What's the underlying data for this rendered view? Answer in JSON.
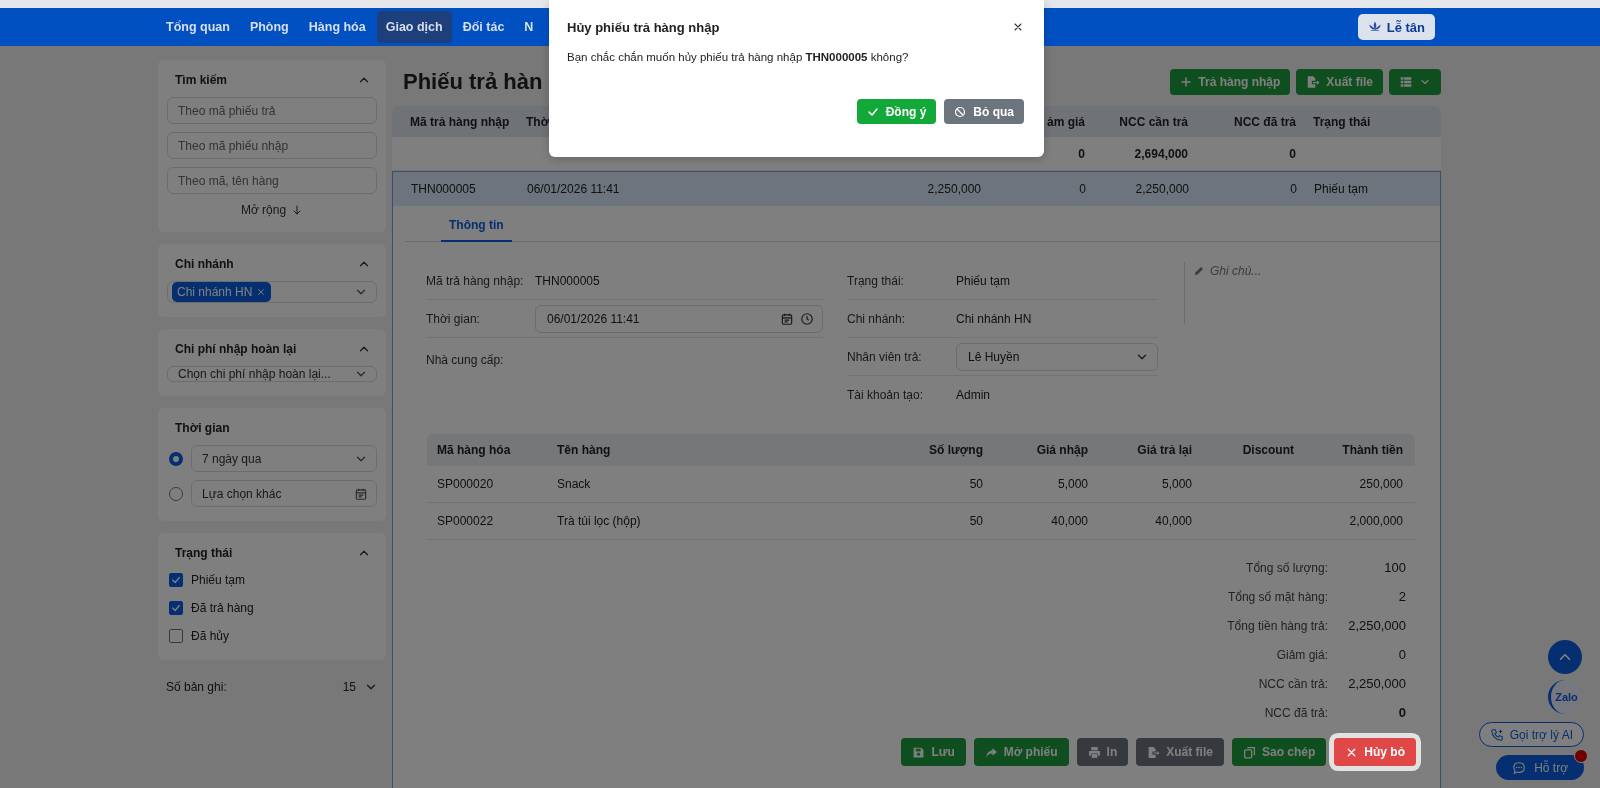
{
  "nav": {
    "items": [
      {
        "label": "Tổng quan",
        "selected": false
      },
      {
        "label": "Phòng",
        "selected": false
      },
      {
        "label": "Hàng hóa",
        "selected": false
      },
      {
        "label": "Giao dịch",
        "selected": true
      },
      {
        "label": "Đối tác",
        "selected": false
      },
      {
        "label": "N",
        "selected": false
      }
    ],
    "reception_button": "Lễ tân"
  },
  "sidebar": {
    "cards": [
      {
        "kind": "search",
        "title": "Tìm kiếm",
        "expanded": true,
        "fields": [
          {
            "placeholder": "Theo mã phiếu trả"
          },
          {
            "placeholder": "Theo mã phiếu nhập"
          },
          {
            "placeholder": "Theo mã, tên hàng"
          }
        ],
        "more_link": "Mở rộng"
      },
      {
        "kind": "tags",
        "title": "Chi nhánh",
        "expanded": true,
        "tags": [
          "Chi nhánh HN"
        ]
      },
      {
        "kind": "select",
        "title": "Chi phí nhập hoàn lại",
        "expanded": true,
        "value": "Chọn chi phí nhập hoàn lại..."
      },
      {
        "kind": "radios",
        "title": "Thời gian",
        "options": [
          {
            "label": "7 ngày qua",
            "selected": true,
            "kind": "select"
          },
          {
            "label": "Lựa chọn khác",
            "selected": false,
            "kind": "date"
          }
        ]
      },
      {
        "kind": "checks",
        "title": "Trạng thái",
        "expanded": true,
        "items": [
          {
            "label": "Phiếu tạm",
            "checked": true
          },
          {
            "label": "Đã trả hàng",
            "checked": true
          },
          {
            "label": "Đã hủy",
            "checked": false
          }
        ]
      }
    ],
    "records": {
      "label": "Số bản ghi:",
      "value": "15"
    }
  },
  "main": {
    "title": "Phiếu trả hàn",
    "actions": [
      {
        "kind": "add",
        "label": "Trả hàng nhập"
      },
      {
        "kind": "export",
        "label": "Xuất file"
      },
      {
        "kind": "columns"
      }
    ],
    "table": {
      "columns": [
        "Mã trả hàng nhập",
        "Thờ",
        null,
        "ảm giá",
        "NCC cần trả",
        "NCC đã trả",
        "Trạng thái"
      ],
      "rows": [
        {
          "kind": "summary",
          "selected": false,
          "cells": [
            null,
            null,
            null,
            "0",
            "2,694,000",
            "0",
            null
          ]
        },
        {
          "kind": "record",
          "selected": true,
          "cells": [
            "THN000005",
            "06/01/2026 11:41",
            "2,250,000",
            "0",
            "2,250,000",
            "0",
            "Phiếu tạm"
          ]
        }
      ]
    },
    "detail": {
      "tabs": [
        {
          "label": "Thông tin",
          "selected": true
        }
      ],
      "left_fields": [
        {
          "kind": "text",
          "label": "Mã trả hàng nhập:",
          "value": "THN000005"
        },
        {
          "kind": "datetime",
          "label": "Thời gian:",
          "value": "06/01/2026 11:41"
        },
        {
          "kind": "text",
          "label": "Nhà cung cấp:"
        }
      ],
      "right_fields": [
        {
          "kind": "text",
          "label": "Trạng thái:",
          "value": "Phiếu tạm"
        },
        {
          "kind": "text",
          "label": "Chi nhánh:",
          "value": "Chi nhánh HN"
        },
        {
          "kind": "select",
          "label": "Nhân viên trả:",
          "value": "Lê Huyền"
        },
        {
          "kind": "text",
          "label": "Tài khoản tạo:",
          "value": "Admin"
        }
      ],
      "note": {
        "placeholder": "Ghi chú..."
      },
      "items": {
        "columns": [
          "Mã hàng hóa",
          "Tên hàng",
          "Số lượng",
          "Giá nhập",
          "Giá trả lại",
          "Discount",
          "Thành tiền"
        ],
        "rows": [
          [
            "SP000020",
            "Snack",
            "50",
            "5,000",
            "5,000",
            null,
            "250,000"
          ],
          [
            "SP000022",
            "Trà túi lọc (hộp)",
            "50",
            "40,000",
            "40,000",
            null,
            "2,000,000"
          ]
        ]
      },
      "totals": [
        {
          "label": "Tổng số lượng:",
          "value": "100",
          "bold": false
        },
        {
          "label": "Tổng số mặt hàng:",
          "value": "2",
          "bold": false
        },
        {
          "label": "Tổng tiền hàng trả:",
          "value": "2,250,000",
          "bold": false
        },
        {
          "label": "Giảm giá:",
          "value": "0",
          "bold": false
        },
        {
          "label": "NCC cần trả:",
          "value": "2,250,000",
          "bold": false
        },
        {
          "label": "NCC đã trả:",
          "value": "0",
          "bold": true
        }
      ],
      "buttons": [
        {
          "kind": "save",
          "label": "Lưu",
          "highlighted": false
        },
        {
          "kind": "open",
          "label": "Mở phiếu",
          "highlighted": false
        },
        {
          "kind": "print",
          "label": "In",
          "highlighted": false
        },
        {
          "kind": "export",
          "label": "Xuất file",
          "highlighted": false
        },
        {
          "kind": "copy",
          "label": "Sao chép",
          "highlighted": false
        },
        {
          "kind": "cancel",
          "label": "Hủy bỏ",
          "highlighted": true
        }
      ]
    }
  },
  "floating": {
    "zalo": "Zalo",
    "ai_call": "Gọi trợ lý AI",
    "support": "Hỗ trợ"
  },
  "dialog": {
    "title": "Hủy phiếu trả hàng nhập",
    "message": "Bạn chắc chắn muốn hủy phiếu trả hàng nhập **THN000005** không?",
    "buttons": [
      {
        "kind": "confirm",
        "label": "Đồng ý"
      },
      {
        "kind": "dismiss",
        "label": "Bỏ qua"
      }
    ]
  }
}
